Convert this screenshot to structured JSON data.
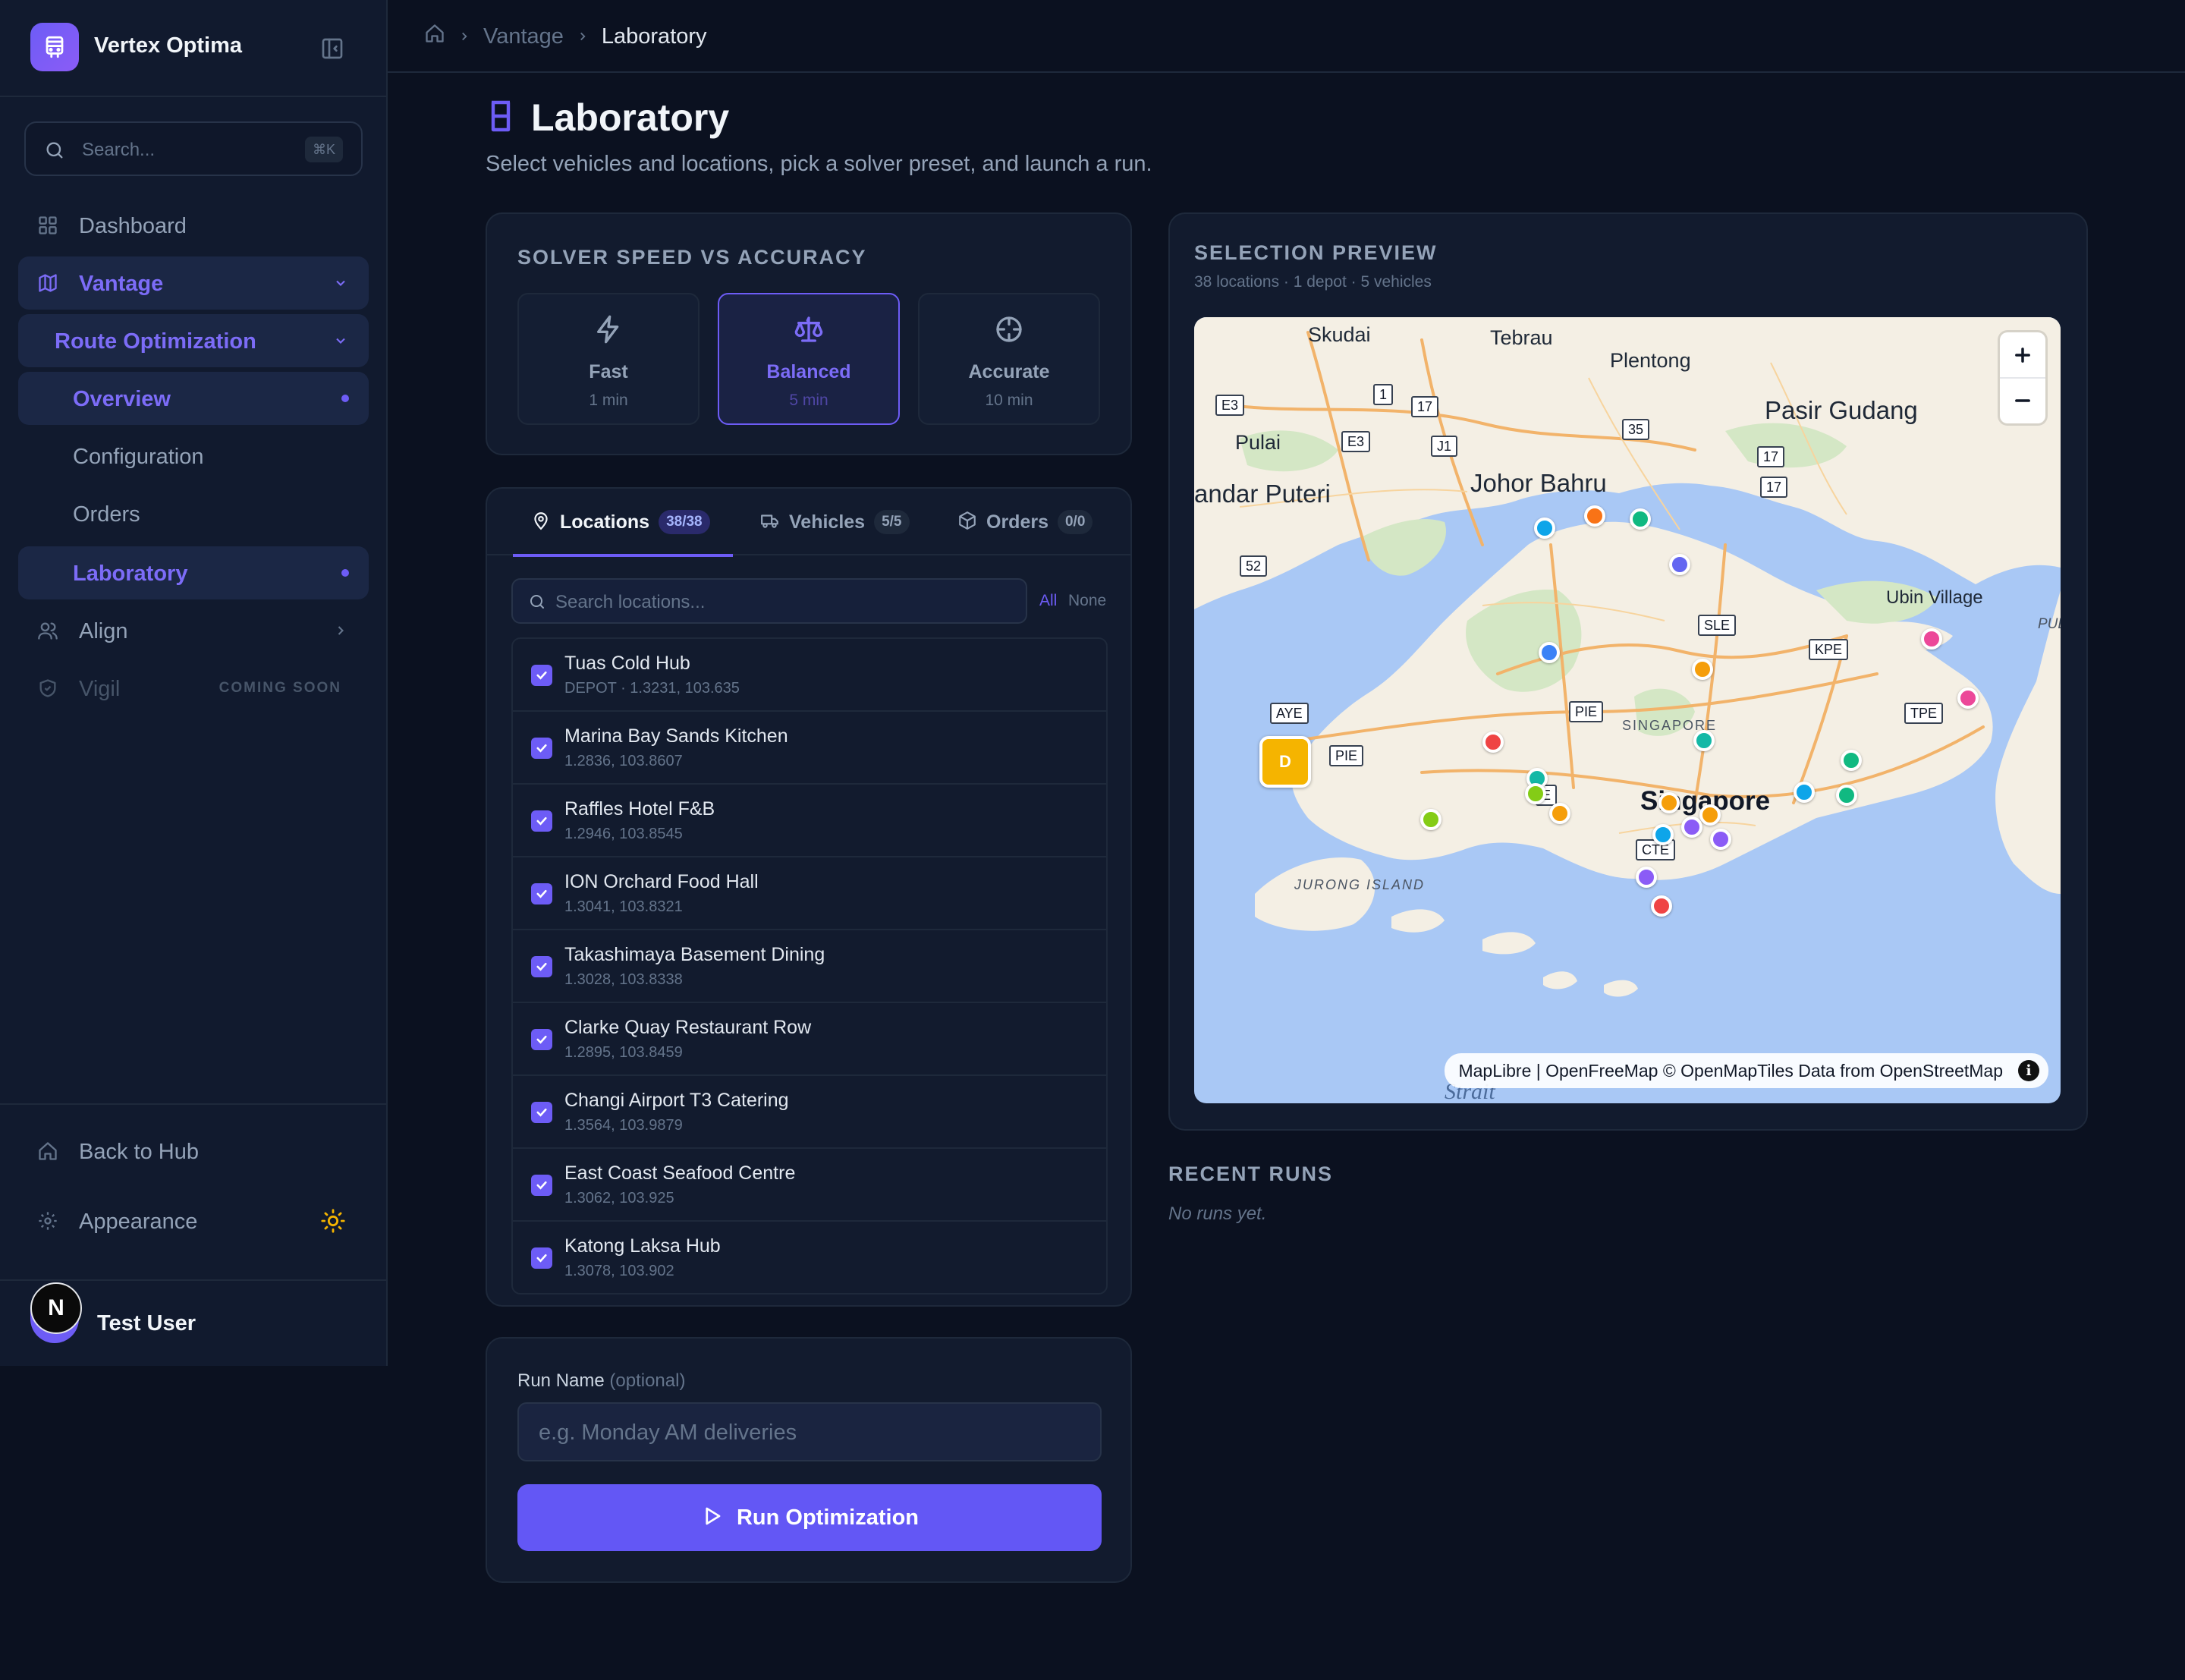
{
  "app": {
    "name": "Vertex Optima"
  },
  "sidebar": {
    "search_placeholder": "Search...",
    "search_shortcut": "⌘K",
    "items": [
      {
        "label": "Dashboard"
      },
      {
        "label": "Vantage"
      },
      {
        "label": "Route Optimization"
      },
      {
        "label": "Overview"
      },
      {
        "label": "Configuration"
      },
      {
        "label": "Orders"
      },
      {
        "label": "Laboratory"
      },
      {
        "label": "Align"
      },
      {
        "label": "Vigil",
        "badge": "COMING SOON"
      }
    ],
    "bottom": [
      {
        "label": "Back to Hub"
      },
      {
        "label": "Appearance"
      }
    ],
    "user": {
      "initial": "N",
      "name": "Test User"
    }
  },
  "breadcrumb": {
    "section": "Vantage",
    "current": "Laboratory"
  },
  "page": {
    "title": "Laboratory",
    "subtitle": "Select vehicles and locations, pick a solver preset, and launch a run."
  },
  "solver": {
    "title": "SOLVER SPEED VS ACCURACY",
    "presets": [
      {
        "name": "Fast",
        "time": "1 min",
        "icon": "lightning-icon"
      },
      {
        "name": "Balanced",
        "time": "5 min",
        "icon": "scale-icon",
        "selected": true
      },
      {
        "name": "Accurate",
        "time": "10 min",
        "icon": "crosshair-icon"
      }
    ]
  },
  "tabs": [
    {
      "label": "Locations",
      "badge": "38/38",
      "active": true
    },
    {
      "label": "Vehicles",
      "badge": "5/5"
    },
    {
      "label": "Orders",
      "badge": "0/0"
    }
  ],
  "locations": {
    "search_placeholder": "Search locations...",
    "select_all": "All",
    "select_none": "None",
    "rows": [
      {
        "name": "Tuas Cold Hub",
        "meta": "DEPOT · 1.3231, 103.635"
      },
      {
        "name": "Marina Bay Sands Kitchen",
        "meta": "1.2836, 103.8607"
      },
      {
        "name": "Raffles Hotel F&B",
        "meta": "1.2946, 103.8545"
      },
      {
        "name": "ION Orchard Food Hall",
        "meta": "1.3041, 103.8321"
      },
      {
        "name": "Takashimaya Basement Dining",
        "meta": "1.3028, 103.8338"
      },
      {
        "name": "Clarke Quay Restaurant Row",
        "meta": "1.2895, 103.8459"
      },
      {
        "name": "Changi Airport T3 Catering",
        "meta": "1.3564, 103.9879"
      },
      {
        "name": "East Coast Seafood Centre",
        "meta": "1.3062, 103.925"
      },
      {
        "name": "Katong Laksa Hub",
        "meta": "1.3078, 103.902"
      }
    ]
  },
  "run": {
    "label": "Run Name",
    "optional": "(optional)",
    "placeholder": "e.g. Monday AM deliveries",
    "button": "Run Optimization"
  },
  "preview": {
    "title": "SELECTION PREVIEW",
    "meta": "38 locations · 1 depot · 5 vehicles",
    "map_labels": [
      "Skudai",
      "Tebrau",
      "Plentong",
      "Pasir Gudang",
      "Pulai",
      "andar Puteri",
      "Johor Bahru",
      "Ubin Village",
      "PUL",
      "SINGAPORE",
      "Singapore",
      "JURONG ISLAND",
      "Strait"
    ],
    "road_shields": [
      "E3",
      "1",
      "17",
      "35",
      "E3",
      "J1",
      "17",
      "17",
      "52",
      "SLE",
      "KPE",
      "AYE",
      "PIE",
      "PIE",
      "TPE",
      "CTE",
      "E"
    ],
    "depot_label": "D",
    "attribution": "MapLibre | OpenFreeMap © OpenMapTiles Data from OpenStreetMap",
    "info_glyph": "i",
    "pin_colors": [
      "#0ea5e9",
      "#f97316",
      "#10b981",
      "#6366f1",
      "#3b82f6",
      "#f59e0b",
      "#ec4899",
      "#ef4444",
      "#14b8a6",
      "#84cc16",
      "#8b5cf6"
    ]
  },
  "recent": {
    "title": "RECENT RUNS",
    "empty": "No runs yet."
  },
  "colors": {
    "accent": "#6d5cf6",
    "bg": "#0b1120",
    "panel": "#121b2e"
  }
}
